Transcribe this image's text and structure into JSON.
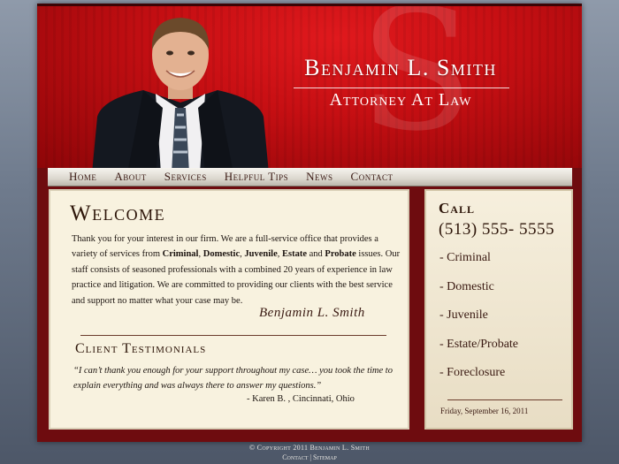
{
  "header": {
    "monogram": "S",
    "firm_name": "Benjamin L. Smith",
    "firm_title": "Attorney At Law"
  },
  "nav": {
    "items": [
      {
        "label": "Home"
      },
      {
        "label": "About"
      },
      {
        "label": "Services"
      },
      {
        "label": "Helpful Tips"
      },
      {
        "label": "News"
      },
      {
        "label": "Contact"
      }
    ]
  },
  "welcome": {
    "title": "Welcome",
    "text_parts": {
      "p1": "Thank you for your interest in our firm. We are a full-service office that provides a variety of services from ",
      "b1": "Criminal",
      "p2": ", ",
      "b2": "Domestic",
      "p3": ", ",
      "b3": "Juvenile",
      "p4": ", ",
      "b4": "Estate",
      "p5": " and ",
      "b5": "Probate",
      "p6": " issues. Our staff consists of seasoned professionals with a combined 20 years of experience in law practice and litigation. We are committed to providing our clients with the best service and support no matter what your case may be."
    },
    "signature": "Benjamin L. Smith"
  },
  "testimonials": {
    "title": "Client Testimonials",
    "quote": "“I can’t thank you enough for your support throughout my case… you took the time to explain everything and was always there to answer my questions.”",
    "author": "- Karen B. , Cincinnati, Ohio"
  },
  "sidebar": {
    "call_label": "Call",
    "phone": "(513) 555- 5555",
    "practice_areas": [
      {
        "label": "- Criminal"
      },
      {
        "label": "- Domestic"
      },
      {
        "label": "- Juvenile"
      },
      {
        "label": "- Estate/Probate"
      },
      {
        "label": "- Foreclosure"
      }
    ],
    "date": "Friday, September 16, 2011"
  },
  "footer": {
    "copyright": "© Copyright 2011 Benjamin L. Smith",
    "contact_link": "Contact",
    "separator": " | ",
    "sitemap_link": "Sitemap"
  },
  "colors": {
    "header_red": "#c70f13",
    "page_maroon": "#6e0c0f",
    "panel_cream": "#f8f2df",
    "text_brown": "#2d1509"
  }
}
